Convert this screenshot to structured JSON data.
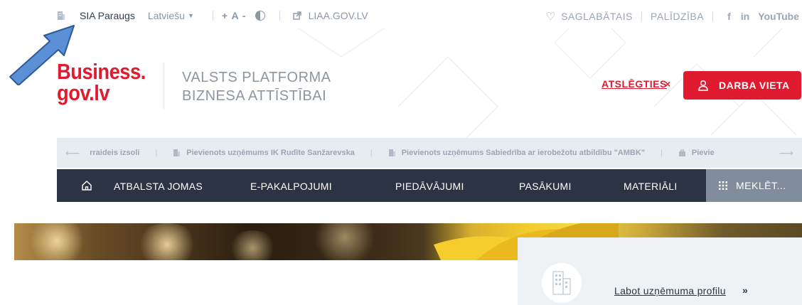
{
  "topbar": {
    "company_name": "SIA Paraugs",
    "language": "Latviešu",
    "font_size_label": "+ A -",
    "site_link": "LIAA.GOV.LV",
    "saved_label": "SAGLABĀTAIS",
    "help_label": "PALĪDZĪBA",
    "social_facebook": "f",
    "social_linkedin": "in",
    "social_youtube": "YouTube"
  },
  "header": {
    "logo_line1": "Business.",
    "logo_line2": "gov.lv",
    "tagline_line1": "VALSTS PLATFORMA",
    "tagline_line2": "BIZNESA ATTĪSTĪBAI",
    "keywords_label": "ATSLĒGTIES",
    "keywords_close": "×",
    "job_button": "DARBA VIETA"
  },
  "ticker": {
    "items": [
      "rraideis izsoli",
      "Pievienots uzņēmums IK Rudīte Sanžarevska",
      "Pievienots uzņēmums Sabiedrība ar ierobežotu atbildību \"AMBK\"",
      "Pievie"
    ]
  },
  "nav": {
    "items": [
      "ATBALSTA JOMAS",
      "E-PAKALPOJUMI",
      "PIEDĀVĀJUMI",
      "PASĀKUMI",
      "MATERIĀLI"
    ],
    "search_label": "MEKLĒT..."
  },
  "profile_card": {
    "link_label": "Labot uzņēmuma profilu",
    "chevron": "»"
  },
  "colors": {
    "brand_red": "#e01b2f",
    "nav_dark": "#2b3445",
    "search_gray": "#818c9c",
    "ticker_bg": "#e6ecf0",
    "annotation_blue": "#5b8fd6"
  }
}
